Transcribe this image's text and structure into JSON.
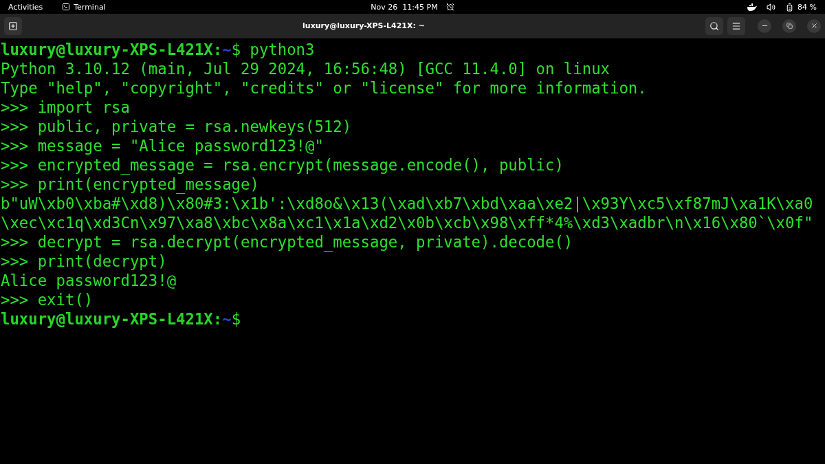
{
  "top_bar": {
    "activities": "Activities",
    "app_name": "Terminal",
    "clock": "Nov 26  11:45 PM",
    "battery": "84 %"
  },
  "window": {
    "title": "luxury@luxury-XPS-L421X: ~"
  },
  "terminal": {
    "lines": [
      {
        "kind": "prompt",
        "user_host": "luxury@luxury-XPS-L421X:",
        "path": "~",
        "symbol": "$",
        "command": "python3"
      },
      {
        "kind": "output",
        "text": "Python 3.10.12 (main, Jul 29 2024, 16:56:48) [GCC 11.4.0] on linux"
      },
      {
        "kind": "output",
        "text": "Type \"help\", \"copyright\", \"credits\" or \"license\" for more information."
      },
      {
        "kind": "output",
        "text": ">>> import rsa"
      },
      {
        "kind": "output",
        "text": ">>> public, private = rsa.newkeys(512)"
      },
      {
        "kind": "output",
        "text": ">>> message = \"Alice password123!@\""
      },
      {
        "kind": "output",
        "text": ">>> encrypted_message = rsa.encrypt(message.encode(), public)"
      },
      {
        "kind": "output",
        "text": ">>> print(encrypted_message)"
      },
      {
        "kind": "output",
        "text": "b\"uW\\xb0\\xba#\\xd8)\\x80#3:\\x1b':\\xd8o&\\x13(\\xad\\xb7\\xbd\\xaa\\xe2|\\x93Y\\xc5\\xf87mJ\\xa1K\\xa0"
      },
      {
        "kind": "output",
        "text": "\\xec\\xc1q\\xd3Cn\\x97\\xa8\\xbc\\x8a\\xc1\\x1a\\xd2\\x0b\\xcb\\x98\\xff*4%\\xd3\\xadbr\\n\\x16\\x80`\\x0f\""
      },
      {
        "kind": "output",
        "text": ">>> decrypt = rsa.decrypt(encrypted_message, private).decode()"
      },
      {
        "kind": "output",
        "text": ">>> print(decrypt)"
      },
      {
        "kind": "output",
        "text": "Alice password123!@"
      },
      {
        "kind": "output",
        "text": ">>> exit()"
      },
      {
        "kind": "prompt",
        "user_host": "luxury@luxury-XPS-L421X:",
        "path": "~",
        "symbol": "$"
      }
    ]
  }
}
